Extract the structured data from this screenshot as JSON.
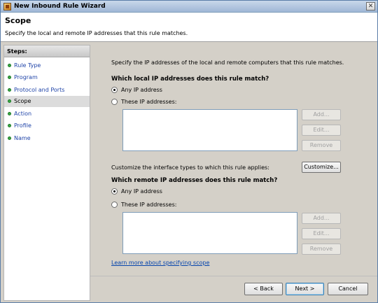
{
  "window": {
    "title": "New Inbound Rule Wizard",
    "close_glyph": "✕"
  },
  "header": {
    "title": "Scope",
    "description": "Specify the local and remote IP addresses that this rule matches."
  },
  "steps": {
    "title": "Steps:",
    "items": [
      {
        "label": "Rule Type",
        "active": false
      },
      {
        "label": "Program",
        "active": false
      },
      {
        "label": "Protocol and Ports",
        "active": false
      },
      {
        "label": "Scope",
        "active": true
      },
      {
        "label": "Action",
        "active": false
      },
      {
        "label": "Profile",
        "active": false
      },
      {
        "label": "Name",
        "active": false
      }
    ]
  },
  "content": {
    "intro": "Specify the IP addresses of the local and remote computers that this rule matches.",
    "local": {
      "heading": "Which local IP addresses does this rule match?",
      "any_label": "Any IP address",
      "these_label": "These IP addresses:",
      "selected": "any",
      "add_label": "Add...",
      "edit_label": "Edit...",
      "remove_label": "Remove"
    },
    "interface_text": "Customize the interface types to which this rule applies:",
    "customize_label": "Customize...",
    "remote": {
      "heading": "Which remote IP addresses does this rule match?",
      "any_label": "Any IP address",
      "these_label": "These IP addresses:",
      "selected": "any",
      "add_label": "Add...",
      "edit_label": "Edit...",
      "remove_label": "Remove"
    },
    "learn_more": "Learn more about specifying scope"
  },
  "footer": {
    "back_label": "< Back",
    "next_label": "Next >",
    "cancel_label": "Cancel"
  }
}
